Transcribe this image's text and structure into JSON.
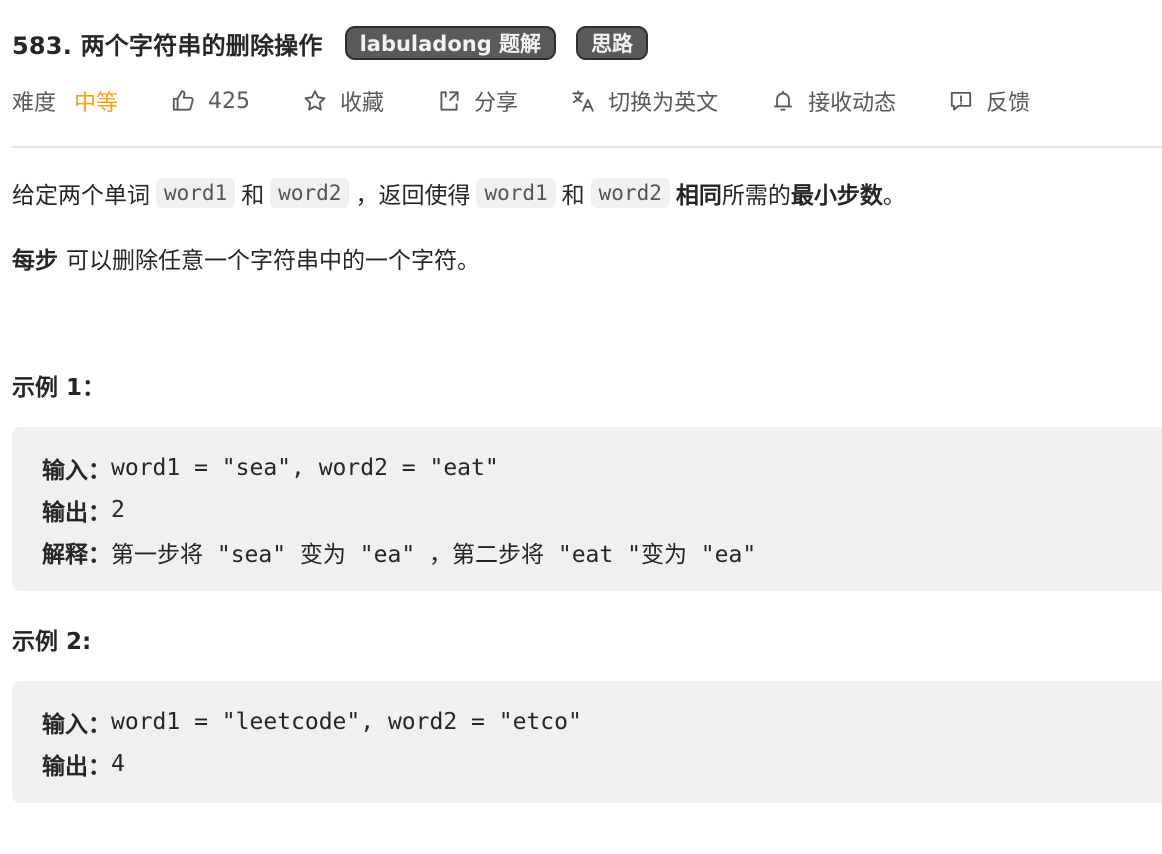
{
  "title": {
    "text": "583. 两个字符串的删除操作",
    "tags": [
      "labuladong 题解",
      "思路"
    ]
  },
  "meta": {
    "difficulty_label": "难度",
    "difficulty_value": "中等",
    "difficulty_color": "#ffa116",
    "likes": "425",
    "favorite_label": "收藏",
    "share_label": "分享",
    "switch_lang_label": "切换为英文",
    "subscribe_label": "接收动态",
    "feedback_label": "反馈",
    "icons": [
      "thumbs-up-icon",
      "star-icon",
      "share-icon",
      "translate-icon",
      "bell-icon",
      "feedback-icon"
    ]
  },
  "description": {
    "p1": {
      "t1": "给定两个单词",
      "c1": "word1",
      "t2": "和",
      "c2": "word2",
      "t3": "，返回使得",
      "c3": "word1",
      "t4": "和",
      "c4": "word2",
      "b1": "相同",
      "t5": "所需的",
      "b2": "最小步数",
      "t6": "。"
    },
    "p2": {
      "b1": "每步",
      "t1": "可以删除任意一个字符串中的一个字符。"
    }
  },
  "examples": [
    {
      "heading": "示例 1：",
      "input_label": "输入：",
      "input_value": "word1 = \"sea\", word2 = \"eat\"",
      "output_label": "输出：",
      "output_value": "2",
      "explain_label": "解释：",
      "explain_value": "第一步将 \"sea\" 变为 \"ea\" ，第二步将 \"eat \"变为 \"ea\""
    },
    {
      "heading": "示例  2:",
      "input_label": "输入：",
      "input_value": "word1 = \"leetcode\", word2 = \"etco\"",
      "output_label": "输出：",
      "output_value": "4"
    }
  ]
}
